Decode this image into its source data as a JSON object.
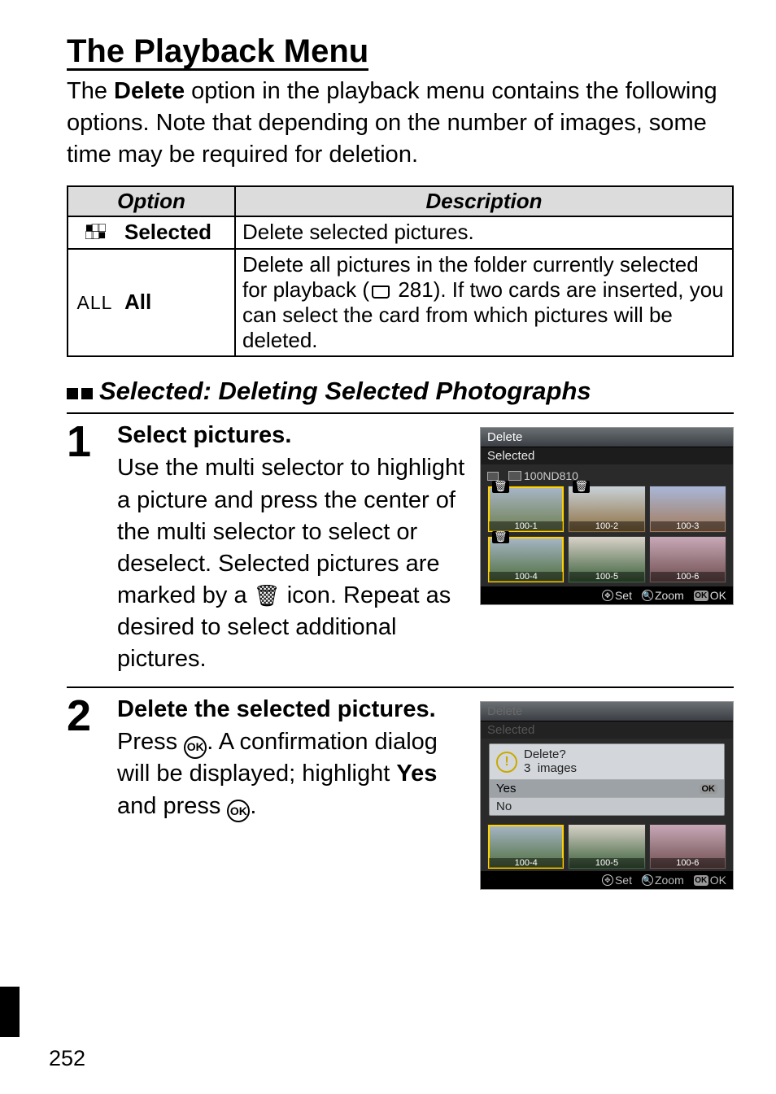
{
  "title": "The Playback Menu",
  "intro_before_bold": "The ",
  "intro_bold": "Delete",
  "intro_after_bold": " option in the playback menu contains the following options.  Note that depending on the number of images, some time may be required for deletion.",
  "table": {
    "head_option": "Option",
    "head_description": "Description",
    "rows": [
      {
        "icon": "selected-glyph",
        "label": "Selected",
        "desc": "Delete selected pictures."
      },
      {
        "icon": "all-glyph",
        "icon_text": "ALL",
        "label": "All",
        "desc_a": "Delete all pictures in the folder currently selected for playback (",
        "desc_ref": "281",
        "desc_b": ").  If two cards are inserted, you can select the card from which pictures will be deleted."
      }
    ]
  },
  "subhead": "Selected: Deleting Selected Photographs",
  "steps": [
    {
      "num": "1",
      "title": "Select pictures.",
      "text_a": "Use the multi selector to highlight a picture and press the center of the multi selector to select or deselect.  Selected pictures are marked by a ",
      "text_b": " icon.  Repeat as desired to select additional pictures."
    },
    {
      "num": "2",
      "title": "Delete the selected pictures.",
      "text_a": "Press ",
      "text_b": ".  A confirmation dialog will be displayed; highlight ",
      "text_bold": "Yes",
      "text_c": " and press ",
      "text_d": "."
    }
  ],
  "screenshot1": {
    "title": "Delete",
    "subtitle": "Selected",
    "folder": "100ND810",
    "thumbs": [
      "100-1",
      "100-2",
      "100-3",
      "100-4",
      "100-5",
      "100-6"
    ],
    "selected_thumbs": [
      0,
      1,
      3
    ],
    "footer_set": "Set",
    "footer_zoom": "Zoom",
    "footer_ok": "OK"
  },
  "screenshot2": {
    "title": "Delete",
    "subtitle": "Selected",
    "confirm_q": "Delete?",
    "confirm_count": "3",
    "confirm_images": "images",
    "yes": "Yes",
    "no": "No",
    "thumbs": [
      "100-4",
      "100-5",
      "100-6"
    ],
    "footer_set": "Set",
    "footer_zoom": "Zoom",
    "footer_ok": "OK"
  },
  "page_number": "252"
}
